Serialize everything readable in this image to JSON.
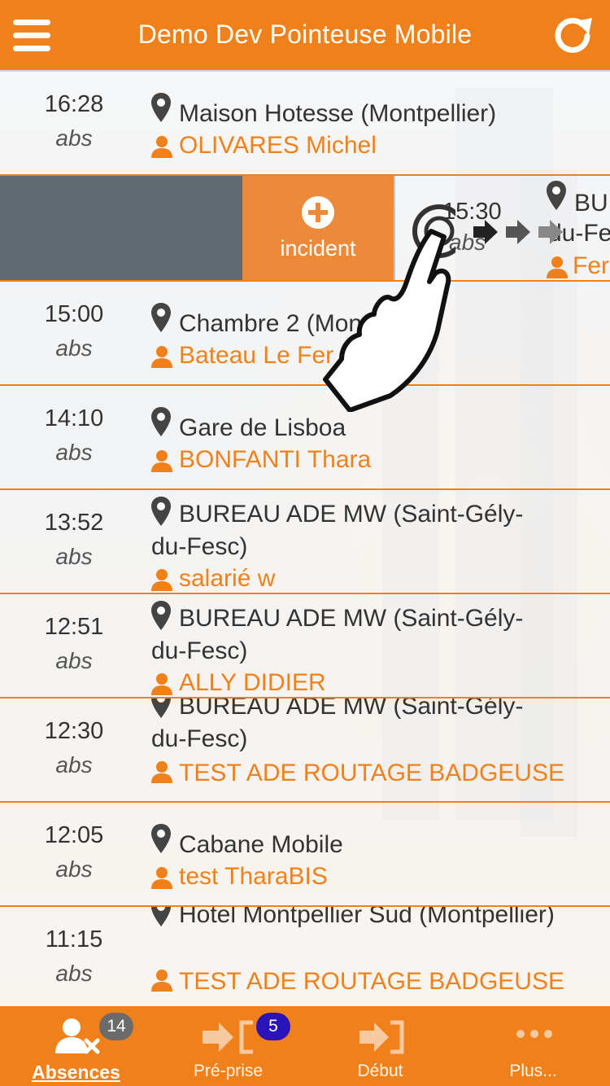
{
  "header": {
    "title": "Demo Dev Pointeuse Mobile"
  },
  "rows": [
    {
      "time": "16:28",
      "status": "abs",
      "location": "Maison Hotesse (Montpellier)",
      "person": "OLIVARES Michel"
    },
    {
      "time": "15:00",
      "status": "abs",
      "location": "Chambre 2 (Montpellier)",
      "person": "Bateau Le Fer"
    },
    {
      "time": "14:10",
      "status": "abs",
      "location": "Gare de Lisboa",
      "person": "BONFANTI Thara"
    },
    {
      "time": "13:52",
      "status": "abs",
      "location": "BUREAU ADE MW (Saint-Gély-du-Fesc)",
      "person": "salarié w"
    },
    {
      "time": "12:51",
      "status": "abs",
      "location": "BUREAU ADE MW (Saint-Gély-du-Fesc)",
      "person": "ALLY DIDIER"
    },
    {
      "time": "12:30",
      "status": "abs",
      "location": "BUREAU ADE MW (Saint-Gély-du-Fesc)",
      "person": "TEST ADE ROUTAGE BADGEUSE"
    },
    {
      "time": "12:05",
      "status": "abs",
      "location": "Cabane Mobile",
      "person": "test TharaBIS"
    },
    {
      "time": "11:15",
      "status": "abs",
      "location": "Hotel Montpellier Sud (Montpellier)",
      "person": "TEST ADE ROUTAGE BADGEUSE"
    }
  ],
  "swiped_row": {
    "action_label": "incident",
    "time": "15:30",
    "status": "abs",
    "location_line1": "BU",
    "location_line2": "du-Fe",
    "person": "Fer"
  },
  "tabs": [
    {
      "label": "Absences",
      "badge": "14",
      "icon": "person-x-icon",
      "active": true
    },
    {
      "label": "Pré-prise",
      "badge": "5",
      "icon": "arrow-in-bracket-icon",
      "active": false
    },
    {
      "label": "Début",
      "badge": "",
      "icon": "arrow-into-door-icon",
      "active": false
    },
    {
      "label": "Plus...",
      "badge": "",
      "icon": "more-dots-icon",
      "active": false
    }
  ],
  "colors": {
    "accent": "#f08019",
    "badge_grey": "#6b6b6b",
    "badge_blue": "#2a13b8",
    "swipe_grey": "#5f6a72"
  }
}
